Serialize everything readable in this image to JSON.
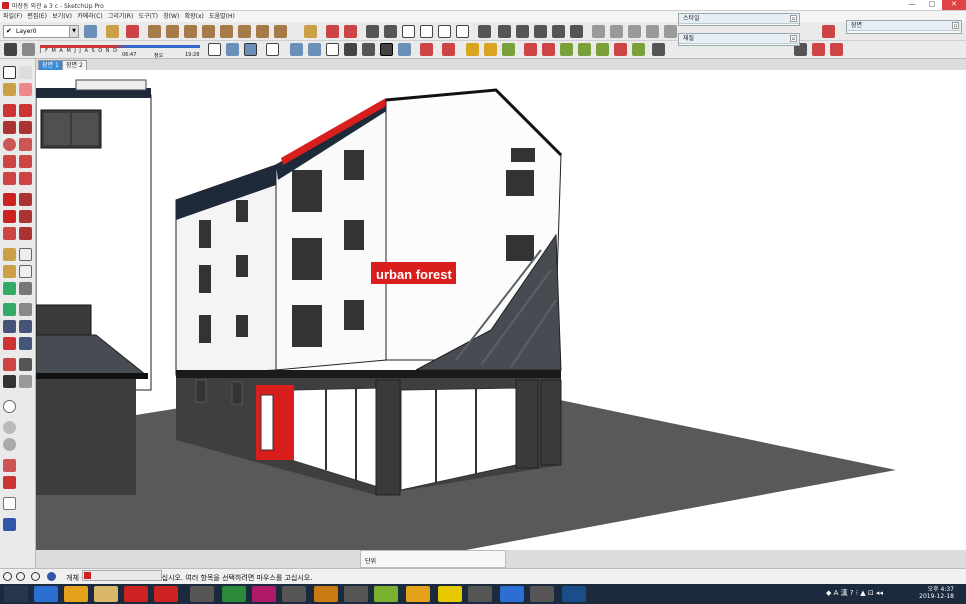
{
  "window": {
    "title": "마장동 외관 a 3 c - SketchUp Pro",
    "min": "—",
    "max": "□",
    "close": "✕"
  },
  "menu": [
    "파일(F)",
    "편집(E)",
    "보기(V)",
    "카메라(C)",
    "그리기(R)",
    "도구(T)",
    "창(W)",
    "확장(x)",
    "도움말(H)"
  ],
  "layer": {
    "value": "Layer0"
  },
  "shadow": {
    "months": "J F M A M J J A S O N D",
    "time_start": "06:47",
    "time_mid": "정오",
    "time_end": "19:28"
  },
  "panels": {
    "style": "스타일",
    "material": "재질",
    "scene": "장면"
  },
  "tabs": [
    "장면 1",
    "장면 2"
  ],
  "sign": {
    "text": "urban forest"
  },
  "measure": {
    "label": "단위"
  },
  "status": {
    "text": "개체 를 확대하려면 Shift를 누르십시오. 여러 항목을 선택하려면 마우스를 고십시오."
  },
  "clock": {
    "time": "오후 4:37",
    "date": "2019-12-18"
  },
  "tray": {
    "text": "◆ A 漢 ? ⁝ ▲ ⊡ ◂◂"
  },
  "colors": {
    "accent_red": "#d91e1e",
    "sky": "#ffffff",
    "ground": "#595959",
    "roof": "#1e2a3a"
  }
}
